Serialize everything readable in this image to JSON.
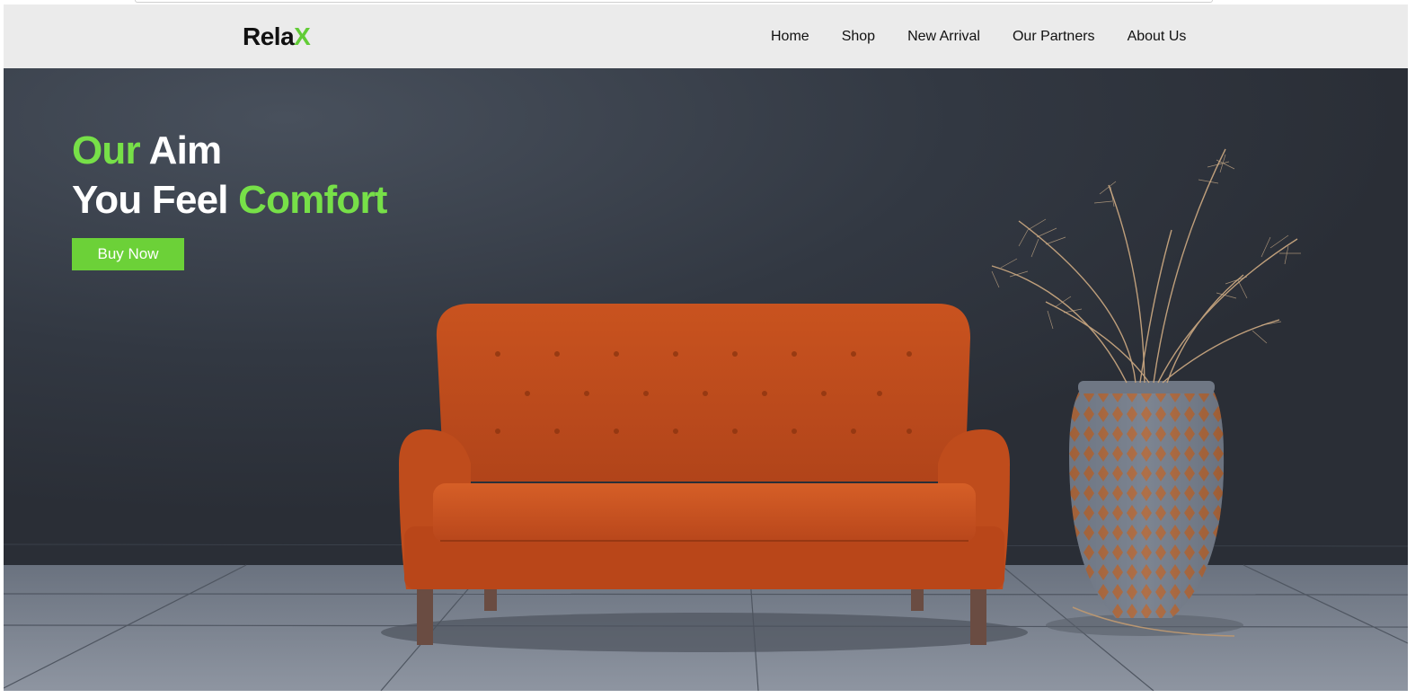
{
  "logo": {
    "main": "Rela",
    "accent": "X"
  },
  "nav": {
    "items": [
      "Home",
      "Shop",
      "New Arrival",
      "Our Partners",
      "About Us"
    ]
  },
  "hero": {
    "line1_green": "Our",
    "line1_white": " Aim",
    "line2_white": "You Feel ",
    "line2_green": "Comfort",
    "cta": "Buy Now"
  },
  "colors": {
    "accent": "#6cd138",
    "navbar_bg": "#ebebeb",
    "hero_bg": "#2d323b",
    "sofa": "#c5501d"
  }
}
